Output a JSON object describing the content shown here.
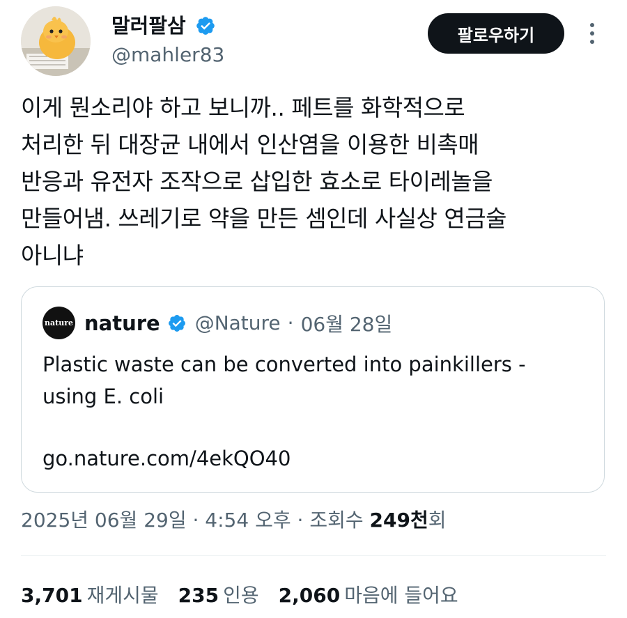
{
  "author": {
    "display_name": "말러팔삼",
    "handle": "@mahler83",
    "verified": true,
    "avatar_icon": "chick-avatar"
  },
  "follow_button": {
    "label": "팔로우하기"
  },
  "more_icon": "more-vertical-icon",
  "tweet": {
    "text": "이게 뭔소리야 하고 보니까.. 페트를 화학적으로\n처리한 뒤 대장균 내에서 인산염을 이용한 비촉매\n반응과 유전자 조작으로 삽입한 효소로 타이레놀을\n만들어냄. 쓰레기로 약을 만든 셈인데 사실상 연금술\n아니냐"
  },
  "quote": {
    "logo_text": "nature",
    "name": "nature",
    "verified": true,
    "handle": "@Nature",
    "separator": "·",
    "date": "06월 28일",
    "text": "Plastic waste can be converted into painkillers -\nusing E. coli",
    "link": "go.nature.com/4ekQO40"
  },
  "meta": {
    "timestamp": "2025년 06월 29일 · 4:54 오후 ·",
    "views_prefix": "조회수",
    "views_count": "249천",
    "views_suffix": "회"
  },
  "stats": [
    {
      "count": "3,701",
      "label": "재게시물"
    },
    {
      "count": "235",
      "label": "인용"
    },
    {
      "count": "2,060",
      "label": "마음에 들어요"
    }
  ],
  "colors": {
    "verified_blue": "#1d9bf0",
    "text_primary": "#0f1419",
    "text_secondary": "#536471",
    "border": "#cfd9de",
    "button_bg": "#0f1419"
  }
}
